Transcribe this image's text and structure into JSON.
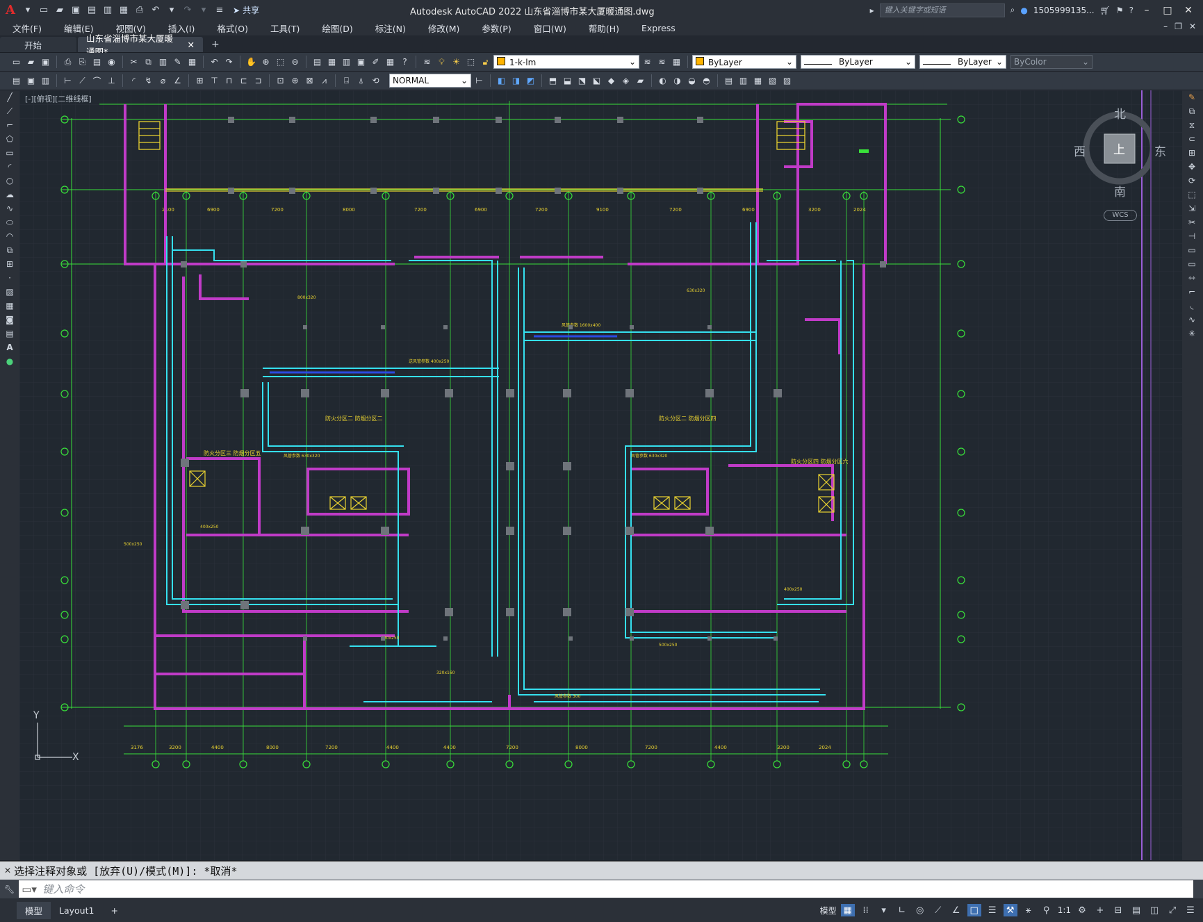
{
  "app": {
    "logo_letter": "A",
    "title": "Autodesk AutoCAD 2022    山东省淄博市某大厦暖通图.dwg",
    "share_label": "共享",
    "search_placeholder": "键入关键字或短语",
    "user_id": "1505999135...",
    "help_icon": "?"
  },
  "menu": [
    "文件(F)",
    "编辑(E)",
    "视图(V)",
    "插入(I)",
    "格式(O)",
    "工具(T)",
    "绘图(D)",
    "标注(N)",
    "修改(M)",
    "参数(P)",
    "窗口(W)",
    "帮助(H)",
    "Express"
  ],
  "tabs": {
    "start": "开始",
    "active": "山东省淄博市某大厦暖通图*",
    "add": "+"
  },
  "toolbar": {
    "layer": "1-k-lm",
    "color": "ByLayer",
    "linetype": "ByLayer",
    "lineweight": "ByLayer",
    "plotstyle": "ByColor",
    "textstyle": "NORMAL"
  },
  "viewport": {
    "label": "[-][俯视][二维线框]",
    "compass": {
      "n": "北",
      "s": "南",
      "e": "东",
      "w": "西",
      "top": "上"
    },
    "wcs": "WCS",
    "ucs_x": "X",
    "ucs_y": "Y",
    "zones": [
      "防火分区二  防烟分区二",
      "防火分区二  防烟分区四",
      "防火分区三  防烟分区五",
      "防火分区四  防烟分区六"
    ],
    "dims_top": [
      "2100",
      "6900",
      "7200",
      "8000",
      "7200",
      "6900",
      "7200",
      "9100",
      "7200",
      "6900",
      "3200",
      "2024"
    ],
    "dims_bottom": [
      "3176",
      "3200",
      "4400",
      "8000",
      "7200",
      "4400",
      "4400",
      "7200",
      "8000",
      "7200",
      "4400",
      "3200",
      "2024"
    ]
  },
  "command": {
    "history": "选择注释对象或 [放弃(U)/模式(M)]: *取消*",
    "placeholder": "键入命令"
  },
  "status": {
    "model_tab": "模型",
    "layout_tab": "Layout1",
    "add": "+",
    "model_btn": "模型",
    "scale": "1:1"
  },
  "colors": {
    "background": "#212830",
    "wall": "#c03bc7",
    "duct": "#35e0ef",
    "grid": "#39e13a",
    "annotation": "#e9d230"
  }
}
